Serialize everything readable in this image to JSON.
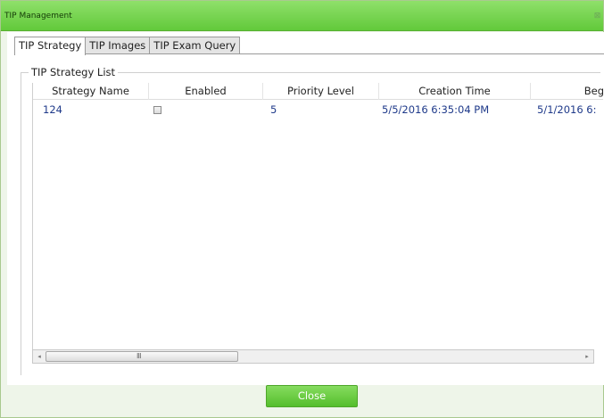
{
  "window": {
    "title": "TIP Management",
    "close_glyph": "⊠"
  },
  "tabs": [
    {
      "label": "TIP Strategy",
      "active": true
    },
    {
      "label": "TIP Images",
      "active": false
    },
    {
      "label": "TIP Exam Query",
      "active": false
    }
  ],
  "group": {
    "title": "TIP Strategy List"
  },
  "grid": {
    "columns": [
      "Strategy Name",
      "Enabled",
      "Priority Level",
      "Creation Time",
      "Beg"
    ],
    "rows": [
      {
        "strategy_name": "124",
        "enabled": false,
        "priority_level": "5",
        "creation_time": "5/5/2016 6:35:04 PM",
        "begin_time": "5/1/2016 6:"
      }
    ]
  },
  "scrollbar": {
    "left_arrow": "◂",
    "right_arrow": "▸",
    "grip": "Ⅲ"
  },
  "footer": {
    "close_label": "Close"
  },
  "icons": {
    "close": "close-icon",
    "scroll_left": "chevron-left-icon",
    "scroll_right": "chevron-right-icon"
  },
  "colors": {
    "accent": "#62c93b",
    "link_text": "#1f3a8a"
  }
}
